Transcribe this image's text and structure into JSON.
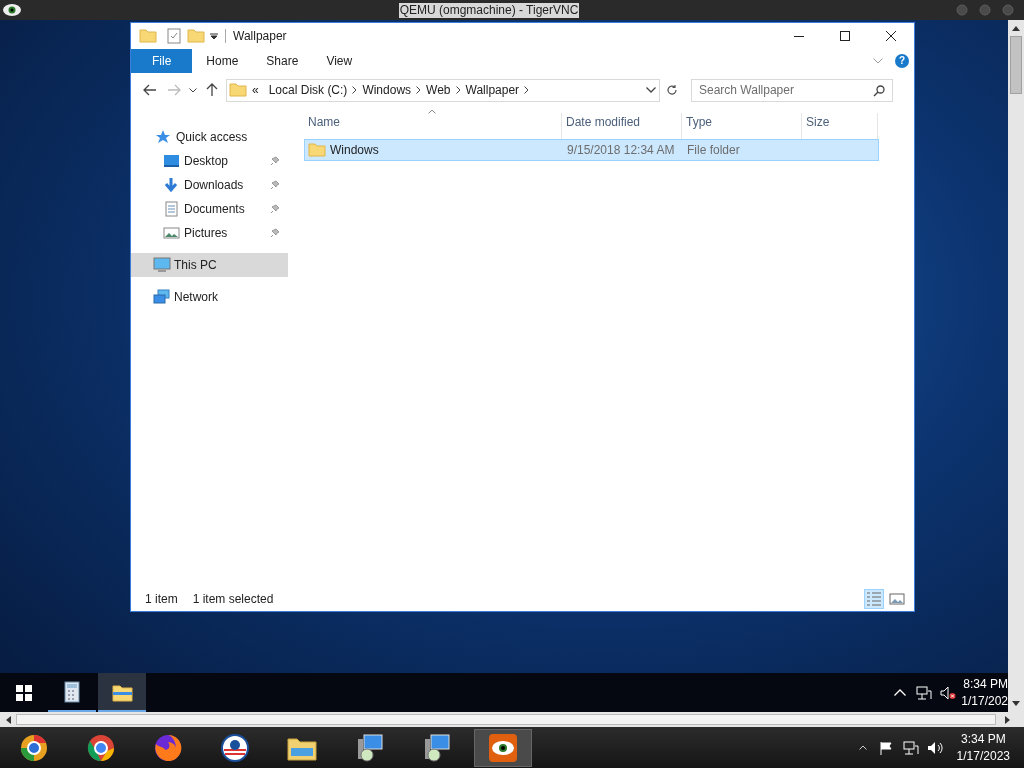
{
  "vnc": {
    "title": "QEMU (omgmachine) - TigerVNC"
  },
  "explorer": {
    "title": "Wallpaper",
    "ribbon_tabs": [
      {
        "label": "File",
        "selected": true
      },
      {
        "label": "Home",
        "selected": false
      },
      {
        "label": "Share",
        "selected": false
      },
      {
        "label": "View",
        "selected": false
      }
    ],
    "help": "?",
    "address": {
      "overflow": "«",
      "crumbs": [
        "Local Disk (C:)",
        "Windows",
        "Web",
        "Wallpaper"
      ]
    },
    "search": {
      "placeholder": "Search Wallpaper"
    },
    "nav": [
      {
        "label": "Quick access",
        "kind": "star",
        "selected": false,
        "children": [
          {
            "label": "Desktop",
            "kind": "desktop",
            "selected": false,
            "pinned": true
          },
          {
            "label": "Downloads",
            "kind": "download",
            "selected": false,
            "pinned": true
          },
          {
            "label": "Documents",
            "kind": "document",
            "selected": false,
            "pinned": true
          },
          {
            "label": "Pictures",
            "kind": "picture",
            "selected": false,
            "pinned": true
          }
        ]
      },
      {
        "label": "This PC",
        "kind": "computer",
        "selected": true
      },
      {
        "label": "Network",
        "kind": "network",
        "selected": false
      }
    ],
    "columns": [
      "Name",
      "Date modified",
      "Type",
      "Size"
    ],
    "rows": [
      {
        "name": "Windows",
        "date_modified": "9/15/2018 12:34 AM",
        "type": "File folder",
        "selected": true
      }
    ],
    "status": {
      "count": "1 item",
      "selection": "1 item selected"
    },
    "views": [
      {
        "kind": "details",
        "selected": true
      },
      {
        "kind": "large-icons",
        "selected": false
      }
    ]
  },
  "guest_taskbar": {
    "apps": [
      {
        "kind": "calculator",
        "selected": false
      },
      {
        "kind": "folder",
        "selected": true
      }
    ],
    "time": "8:34 PM",
    "date": "1/17/202"
  },
  "host_taskbar": {
    "apps": [
      {
        "kind": "orb",
        "selected": false
      },
      {
        "kind": "round-browser",
        "selected": false
      },
      {
        "kind": "fox-browser",
        "selected": false
      },
      {
        "kind": "seal",
        "selected": false
      },
      {
        "kind": "folder",
        "selected": false
      },
      {
        "kind": "monitor-disc",
        "selected": false
      },
      {
        "kind": "monitor-disc",
        "selected": false
      },
      {
        "kind": "eye",
        "selected": true
      }
    ],
    "time": "3:34 PM",
    "date": "1/17/2023"
  }
}
